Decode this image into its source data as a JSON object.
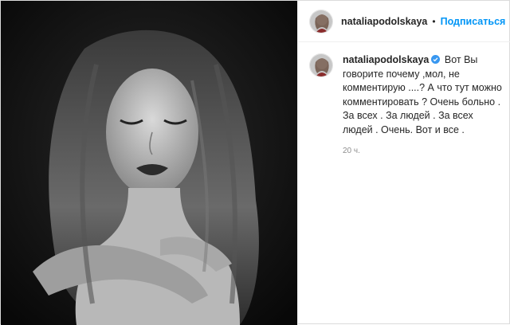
{
  "post": {
    "username": "nataliapodolskaya",
    "follow_label": "Подписаться",
    "separator": "•",
    "caption_text": "Вот Вы говорите почему ,мол, не комментирую ....? А что тут можно комментировать ? Очень больно . За всех . За людей . За всех людей . Очень. Вот и все .",
    "time_ago": "20 ч."
  },
  "colors": {
    "accent": "#0095f6",
    "verified": "#3897f0",
    "text": "#262626",
    "muted": "#8e8e8e"
  },
  "icons": {
    "verified": "verified-badge-icon"
  }
}
